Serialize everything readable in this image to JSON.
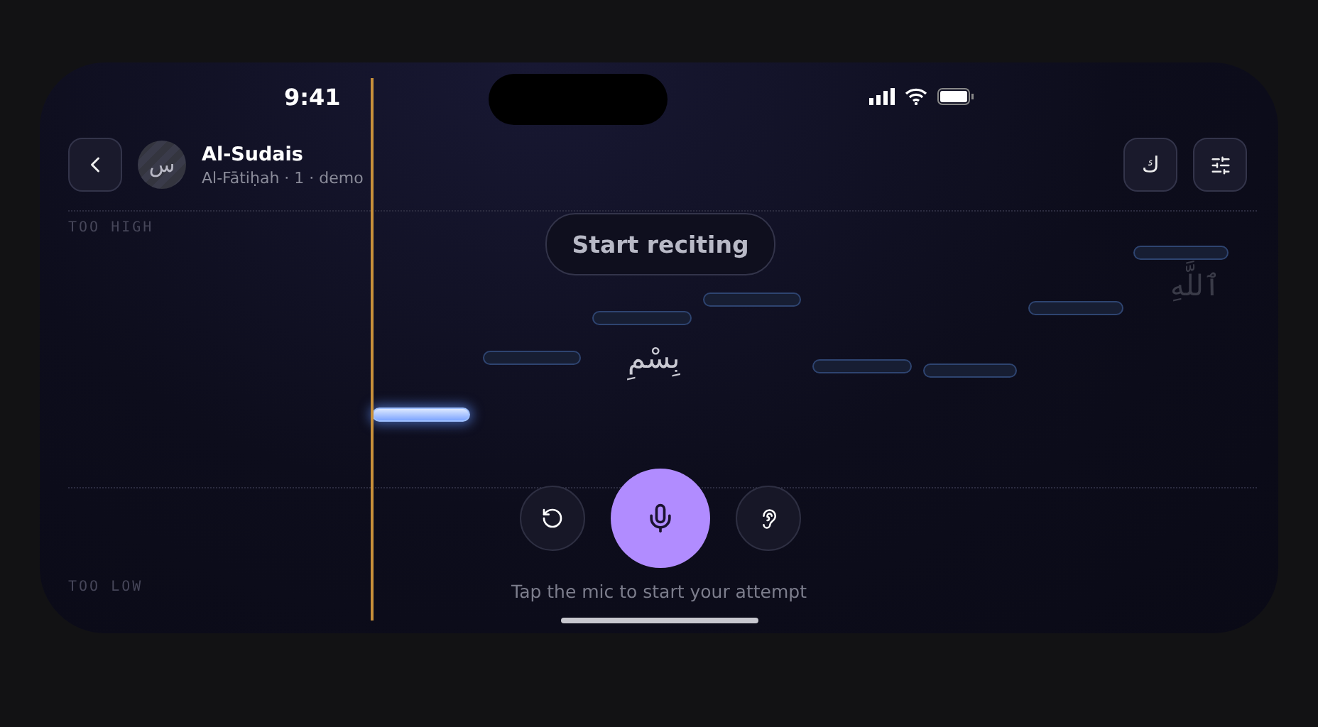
{
  "status_bar": {
    "time": "9:41"
  },
  "header": {
    "title": "Al-Sudais",
    "subtitle": "Al-Fātiḥah · 1 · demo",
    "avatar": "س",
    "script_button": "ك"
  },
  "pitch_labels": {
    "high": "TOO HIGH",
    "low": "TOO LOW"
  },
  "prompt": "Start reciting",
  "notes": [
    {
      "active": true
    },
    {
      "active": false
    },
    {
      "active": false
    },
    {
      "active": false
    },
    {
      "active": false
    },
    {
      "active": false
    },
    {
      "active": false
    },
    {
      "active": false
    }
  ],
  "words": [
    {
      "text": "بِسْمِ",
      "faded": false
    },
    {
      "text": "ٱللَّهِ",
      "faded": true
    }
  ],
  "controls": {
    "recording": false
  },
  "hint": "Tap the mic to start your attempt"
}
